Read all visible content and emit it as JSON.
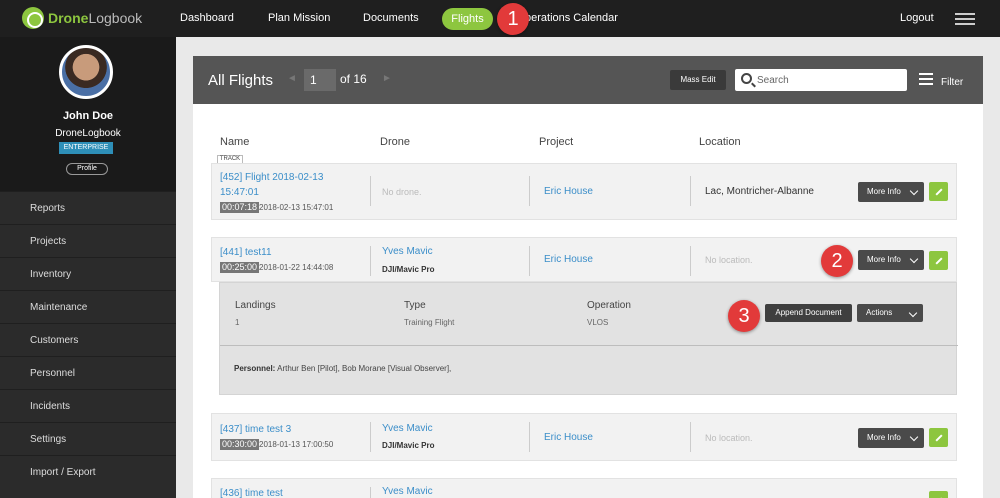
{
  "brand": {
    "part1": "Drone",
    "part2": "Logbook"
  },
  "nav": {
    "dashboard": "Dashboard",
    "plan_mission": "Plan Mission",
    "documents": "Documents",
    "flights": "Flights",
    "operations_calendar": "perations Calendar",
    "logout": "Logout"
  },
  "callouts": [
    "1",
    "2",
    "3"
  ],
  "user": {
    "name": "John Doe",
    "company": "DroneLogbook",
    "plan": "ENTERPRISE",
    "profile_button": "Profile"
  },
  "sidebar": {
    "items": [
      {
        "label": "Reports"
      },
      {
        "label": "Projects"
      },
      {
        "label": "Inventory"
      },
      {
        "label": "Maintenance"
      },
      {
        "label": "Customers"
      },
      {
        "label": "Personnel"
      },
      {
        "label": "Incidents"
      },
      {
        "label": "Settings"
      },
      {
        "label": "Import / Export"
      }
    ]
  },
  "panel": {
    "title": "All Flights",
    "prev_arrow": "◄",
    "next_arrow": "►",
    "page": "1",
    "of_pages": "of 16",
    "mass_edit": "Mass Edit",
    "search_placeholder": "Search",
    "filter": "Filter"
  },
  "columns": {
    "name": "Name",
    "drone": "Drone",
    "project": "Project",
    "location": "Location"
  },
  "track_tag": "TRACK",
  "flights": [
    {
      "name": "[452] Flight 2018-02-13 15:47:01",
      "name_line1": "[452] Flight 2018-02-13",
      "name_line2": "15:47:01",
      "duration": "00:07:18",
      "date": "2018-02-13 15:47:01",
      "drone": "No drone.",
      "project": "Eric House",
      "location": "Lac, Montricher-Albanne",
      "more_info": "More Info"
    },
    {
      "name": "[441] test11",
      "duration": "00:25:00",
      "date": "2018-01-22 14:44:08",
      "pilot": "Yves Mavic",
      "drone_model": "DJI/Mavic Pro",
      "project": "Eric House",
      "location": "No location.",
      "more_info": "More Info"
    },
    {
      "name": "[437] time test 3",
      "duration": "00:30:00",
      "date": "2018-01-13 17:00:50",
      "pilot": "Yves Mavic",
      "drone_model": "DJI/Mavic Pro",
      "project": "Eric House",
      "location": "No location.",
      "more_info": "More Info"
    },
    {
      "name": "[436] time test",
      "pilot": "Yves Mavic"
    }
  ],
  "details": {
    "landings_label": "Landings",
    "landings_value": "1",
    "type_label": "Type",
    "type_value": "Training Flight",
    "operation_label": "Operation",
    "operation_value": "VLOS",
    "append_document": "Append Document",
    "actions": "Actions",
    "personnel_label": "Personnel:",
    "personnel_value": "Arthur Ben [Pilot], Bob Morane [Visual Observer],"
  },
  "colors": {
    "accent_green": "#8dc63f",
    "link_blue": "#3b8ec9",
    "callout_red": "#e23a3a",
    "topbar": "#1f1f1f"
  }
}
